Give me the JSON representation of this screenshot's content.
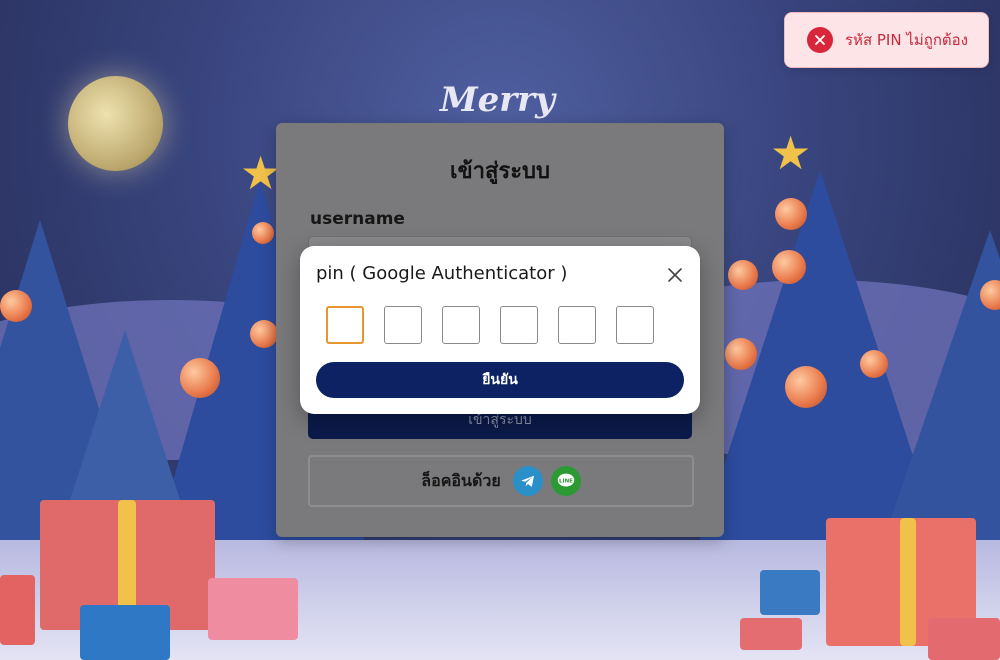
{
  "login": {
    "title": "เข้าสู่ระบบ",
    "username_label": "username",
    "login_button": "เข้าสู่ระบบ",
    "social_label": "ล็อคอินด้วย",
    "social_icons": [
      "telegram-icon",
      "line-icon"
    ]
  },
  "modal": {
    "title": "pin ( Google Authenticator )",
    "pin_length": 6,
    "confirm_button": "ยืนยัน",
    "close_icon": "close-icon",
    "focus_color": "#e6962e"
  },
  "toast": {
    "message": "รหัส PIN ไม่ถูกต้อง",
    "icon": "error-x-icon",
    "color": "#d8263a"
  },
  "background": {
    "greeting": "Merry"
  },
  "colors": {
    "primary": "#0d2262"
  }
}
